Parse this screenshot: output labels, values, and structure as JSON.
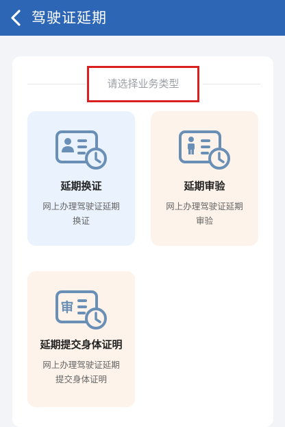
{
  "header": {
    "title": "驾驶证延期",
    "back_icon": "chevron-left-icon",
    "bg_color": "#2c66b4"
  },
  "section": {
    "title": "请选择业务类型"
  },
  "cards": [
    {
      "title": "延期换证",
      "desc_line1": "网上办理驾驶证延期",
      "desc_line2": "换证",
      "icon": "id-card-clock-icon",
      "bg_color": "#e9f2fd"
    },
    {
      "title": "延期审验",
      "desc_line1": "网上办理驾驶证延期",
      "desc_line2": "审验",
      "icon": "person-card-clock-icon",
      "bg_color": "#fdf3ea"
    },
    {
      "title": "延期提交身体证明",
      "desc_line1": "网上办理驾驶证延期",
      "desc_line2": "提交身体证明",
      "icon": "review-card-clock-icon",
      "icon_text": "审",
      "bg_color": "#fdf3ea"
    }
  ],
  "colors": {
    "icon_stroke": "#6a8fb6",
    "highlight_border": "#d9201f"
  }
}
